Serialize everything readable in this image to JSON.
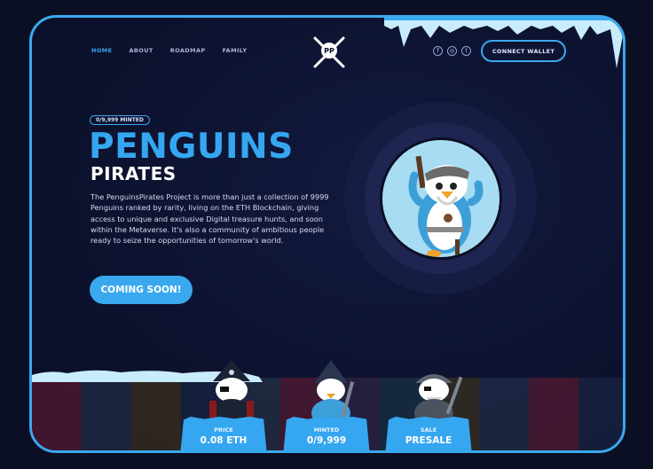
{
  "nav": {
    "items": [
      {
        "label": "HOME",
        "active": true
      },
      {
        "label": "ABOUT",
        "active": false
      },
      {
        "label": "ROADMAP",
        "active": false
      },
      {
        "label": "FAMILY",
        "active": false
      }
    ]
  },
  "logo": {
    "text": "PP"
  },
  "socials": {
    "items": [
      {
        "icon": "facebook-icon",
        "glyph": "f"
      },
      {
        "icon": "instagram-icon",
        "glyph": "◎"
      },
      {
        "icon": "twitter-icon",
        "glyph": "t"
      }
    ]
  },
  "header": {
    "connect_label": "CONNECT WALLET"
  },
  "hero": {
    "minted_badge": "0/9,999 MINTED",
    "title_line1": "PENGUINS",
    "title_line2": "PIRATES",
    "description": "The PenguinsPirates Project is more than just a collection of 9999 Penguins ranked by rarity, living on the ETH Blockchain, giving access to unique and exclusive Digital treasure hunts, and soon within the Metaverse. It's also a community of ambitious people ready to seize the opportunities of tomorrow's world.",
    "cta_label": "COMING SOON!"
  },
  "stats": [
    {
      "label": "PRICE",
      "value": "0.08 ETH"
    },
    {
      "label": "MINTED",
      "value": "0/9,999"
    },
    {
      "label": "SALE",
      "value": "PRESALE"
    }
  ],
  "colors": {
    "accent": "#3aa8ee",
    "background": "#0b0f24",
    "portal": "#a7dcf3"
  }
}
